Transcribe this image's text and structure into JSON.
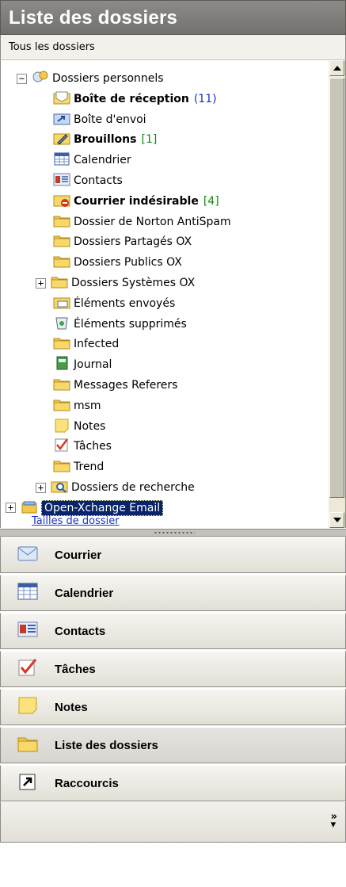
{
  "title": "Liste des dossiers",
  "subheader": "Tous les dossiers",
  "tree": [
    {
      "label": "Dossiers personnels",
      "bold": false,
      "count": "",
      "count_color": "",
      "expander": "minus",
      "icon": "personal-folders-icon"
    },
    {
      "label": "Boîte de réception",
      "bold": true,
      "count": "(11)",
      "count_color": "blue",
      "expander": "",
      "icon": "inbox-icon"
    },
    {
      "label": "Boîte d'envoi",
      "bold": false,
      "count": "",
      "count_color": "",
      "expander": "",
      "icon": "outbox-icon"
    },
    {
      "label": "Brouillons",
      "bold": true,
      "count": "[1]",
      "count_color": "green",
      "expander": "",
      "icon": "drafts-icon"
    },
    {
      "label": "Calendrier",
      "bold": false,
      "count": "",
      "count_color": "",
      "expander": "",
      "icon": "calendar-icon"
    },
    {
      "label": "Contacts",
      "bold": false,
      "count": "",
      "count_color": "",
      "expander": "",
      "icon": "contacts-icon"
    },
    {
      "label": "Courrier indésirable",
      "bold": true,
      "count": "[4]",
      "count_color": "green",
      "expander": "",
      "icon": "junk-mail-icon"
    },
    {
      "label": "Dossier de Norton AntiSpam",
      "bold": false,
      "count": "",
      "count_color": "",
      "expander": "",
      "icon": "folder-icon"
    },
    {
      "label": "Dossiers Partagés OX",
      "bold": false,
      "count": "",
      "count_color": "",
      "expander": "",
      "icon": "folder-icon"
    },
    {
      "label": "Dossiers Publics OX",
      "bold": false,
      "count": "",
      "count_color": "",
      "expander": "",
      "icon": "folder-icon"
    },
    {
      "label": "Dossiers Systèmes OX",
      "bold": false,
      "count": "",
      "count_color": "",
      "expander": "plus",
      "icon": "folder-icon"
    },
    {
      "label": "Éléments envoyés",
      "bold": false,
      "count": "",
      "count_color": "",
      "expander": "",
      "icon": "sent-items-icon"
    },
    {
      "label": "Éléments supprimés",
      "bold": false,
      "count": "",
      "count_color": "",
      "expander": "",
      "icon": "deleted-items-icon"
    },
    {
      "label": "Infected",
      "bold": false,
      "count": "",
      "count_color": "",
      "expander": "",
      "icon": "folder-icon"
    },
    {
      "label": "Journal",
      "bold": false,
      "count": "",
      "count_color": "",
      "expander": "",
      "icon": "journal-icon"
    },
    {
      "label": "Messages Referers",
      "bold": false,
      "count": "",
      "count_color": "",
      "expander": "",
      "icon": "folder-icon"
    },
    {
      "label": "msm",
      "bold": false,
      "count": "",
      "count_color": "",
      "expander": "",
      "icon": "folder-icon"
    },
    {
      "label": "Notes",
      "bold": false,
      "count": "",
      "count_color": "",
      "expander": "",
      "icon": "notes-icon"
    },
    {
      "label": "Tâches",
      "bold": false,
      "count": "",
      "count_color": "",
      "expander": "",
      "icon": "tasks-icon"
    },
    {
      "label": "Trend",
      "bold": false,
      "count": "",
      "count_color": "",
      "expander": "",
      "icon": "folder-icon"
    },
    {
      "label": "Dossiers de recherche",
      "bold": false,
      "count": "",
      "count_color": "",
      "expander": "plus",
      "icon": "search-folders-icon"
    },
    {
      "label": "Open-Xchange Email",
      "bold": false,
      "count": "",
      "count_color": "",
      "expander": "plus",
      "icon": "mail-account-icon",
      "selected": true
    }
  ],
  "folder_sizes_link": "Tailles de dossier",
  "nav": [
    {
      "label": "Courrier",
      "icon": "mail-icon",
      "active": false
    },
    {
      "label": "Calendrier",
      "icon": "calendar-icon",
      "active": false
    },
    {
      "label": "Contacts",
      "icon": "contacts-icon",
      "active": false
    },
    {
      "label": "Tâches",
      "icon": "tasks-icon",
      "active": false
    },
    {
      "label": "Notes",
      "icon": "notes-icon",
      "active": false
    },
    {
      "label": "Liste des dossiers",
      "icon": "folder-icon",
      "active": true
    },
    {
      "label": "Raccourcis",
      "icon": "shortcut-icon",
      "active": false
    }
  ],
  "nav_footer_chevron": "»",
  "colors": {
    "title_bar": "#7f7e7a",
    "link": "#1a33c8",
    "count_blue": "#1a33c8",
    "count_green": "#108a10",
    "selection": "#0a246a"
  }
}
